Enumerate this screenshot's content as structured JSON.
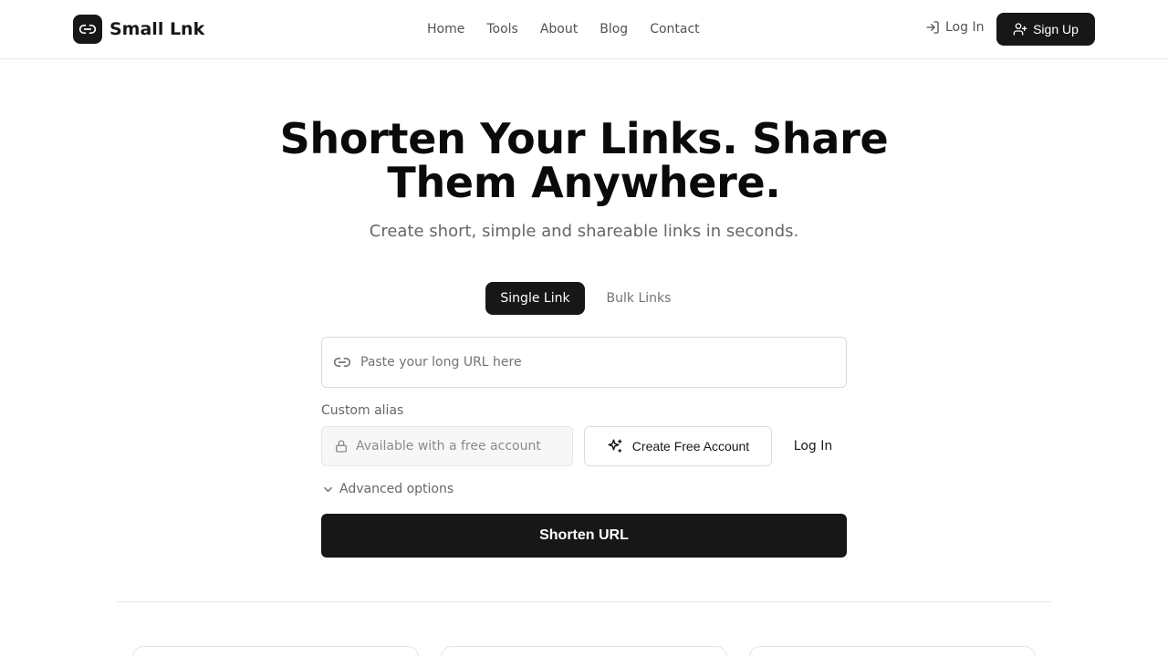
{
  "brand": {
    "name": "Small Lnk",
    "logo_icon": "link-icon"
  },
  "nav": {
    "items": [
      "Home",
      "Tools",
      "About",
      "Blog",
      "Contact"
    ]
  },
  "auth": {
    "login_label": "Log In",
    "signup_label": "Sign Up"
  },
  "hero": {
    "title_line1": "Shorten Your Links. Share",
    "title_line2": "Them Anywhere.",
    "subtitle": "Create short, simple and shareable links in seconds."
  },
  "tabs": [
    {
      "label": "Single Link",
      "active": true
    },
    {
      "label": "Bulk Links",
      "active": false
    }
  ],
  "form": {
    "url_placeholder": "Paste your long URL here",
    "alias_label": "Custom alias",
    "alias_placeholder": "Available with a free account",
    "create_account_label": "Create Free Account",
    "login_label": "Log In",
    "advanced_label": "Advanced options",
    "submit_label": "Shorten URL"
  },
  "colors": {
    "primary": "#171717",
    "border": "#e5e5e5",
    "muted_text": "#666666"
  }
}
